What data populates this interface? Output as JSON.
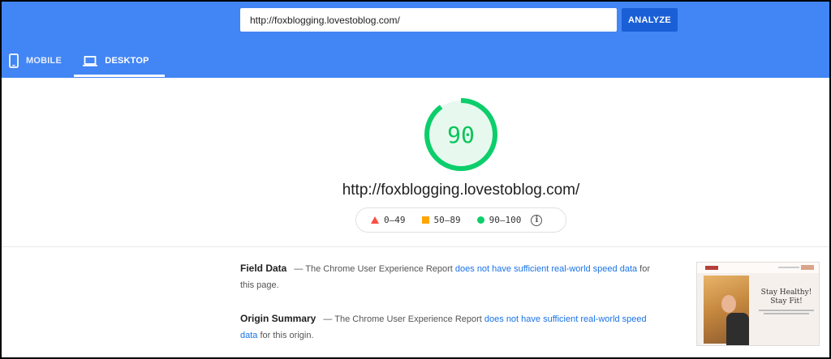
{
  "search": {
    "url_value": "http://foxblogging.lovestoblog.com/",
    "analyze_label": "ANALYZE"
  },
  "tabs": [
    {
      "label": "MOBILE",
      "icon": "phone-icon",
      "active": false
    },
    {
      "label": "DESKTOP",
      "icon": "laptop-icon",
      "active": true
    }
  ],
  "score": {
    "value": "90",
    "fraction": 0.9,
    "color": "#0cce6b",
    "tested_url": "http://foxblogging.lovestoblog.com/"
  },
  "legend": [
    {
      "range": "0–49",
      "shape": "triangle",
      "color": "#ff4e42"
    },
    {
      "range": "50–89",
      "shape": "square",
      "color": "#ffa400"
    },
    {
      "range": "90–100",
      "shape": "circle",
      "color": "#0cce6b"
    }
  ],
  "field_data": {
    "title": "Field Data",
    "prefix": " — The Chrome User Experience Report ",
    "link": "does not have sufficient real-world speed data",
    "suffix": " for this page."
  },
  "origin_summary": {
    "title": "Origin Summary",
    "prefix": " — The Chrome User Experience Report ",
    "link": "does not have sufficient real-world speed data",
    "suffix": " for this origin."
  },
  "thumbnail": {
    "heading_line1": "Stay Healthy!",
    "heading_line2": "Stay Fit!"
  },
  "colors": {
    "header": "#4285f4",
    "analyze_button": "#1a5fd6",
    "link": "#1a73e8"
  }
}
